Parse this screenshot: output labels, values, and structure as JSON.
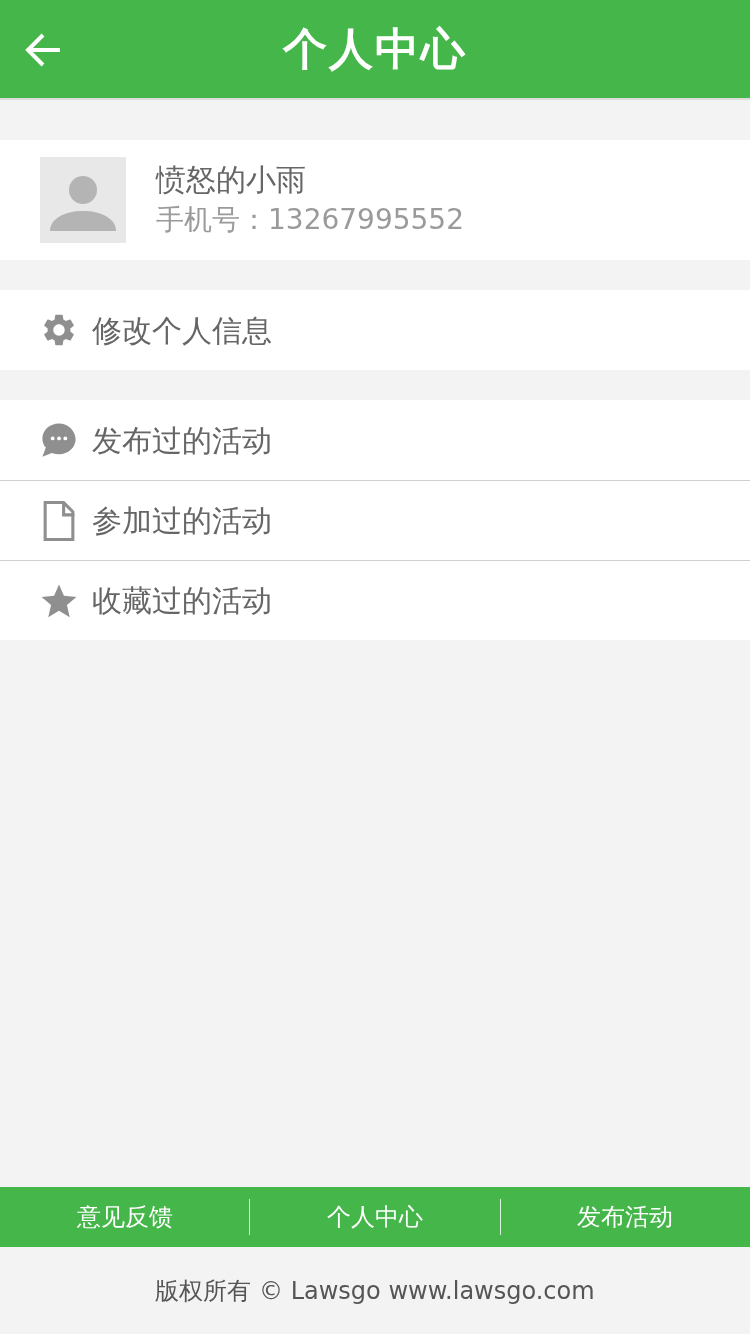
{
  "header": {
    "title": "个人中心"
  },
  "profile": {
    "name": "愤怒的小雨",
    "phone": "手机号：13267995552"
  },
  "menu_groups": [
    {
      "items": [
        {
          "kind": "gear",
          "label": "修改个人信息"
        }
      ]
    },
    {
      "items": [
        {
          "kind": "chat",
          "label": "发布过的活动"
        },
        {
          "kind": "document",
          "label": "参加过的活动"
        },
        {
          "kind": "star",
          "label": "收藏过的活动"
        }
      ]
    }
  ],
  "bottom_nav": [
    {
      "label": "意见反馈"
    },
    {
      "label": "个人中心"
    },
    {
      "label": "发布活动"
    }
  ],
  "footer": "版权所有 © Lawsgo www.lawsgo.com"
}
